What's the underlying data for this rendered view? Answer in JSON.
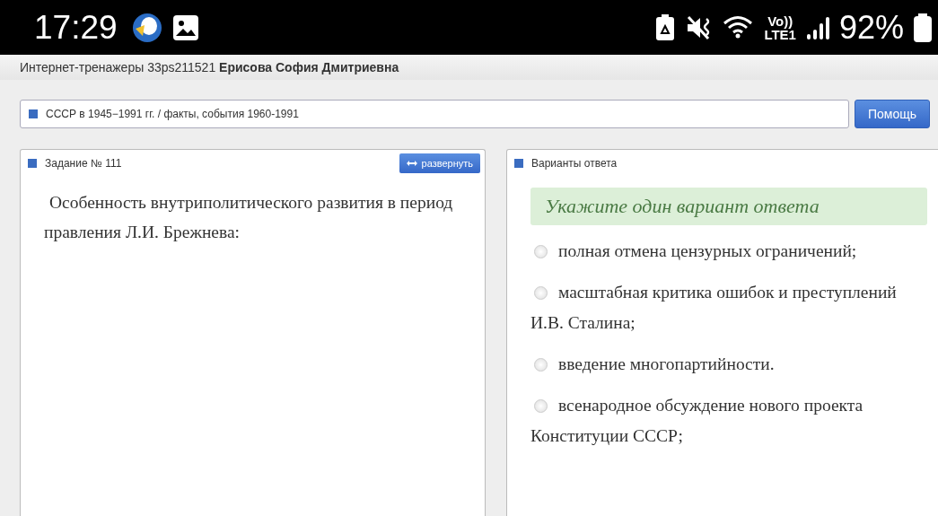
{
  "status_bar": {
    "time": "17:29",
    "network": "Vo))",
    "network_type": "LTE1",
    "battery": "92%"
  },
  "header": {
    "text": "Интернет-тренажеры 33ps211521 **Ерисова София Дмитриевна**"
  },
  "topic": {
    "text": "СССР в 1945−1991 гг. / факты, события 1960-1991",
    "help_button": "Помощь"
  },
  "task": {
    "title": "Задание № 111",
    "expand_button": "развернуть",
    "question": "Особенность внутриполитического развития в период правления Л.И. Брежнева:"
  },
  "answers": {
    "title": "Варианты ответа",
    "instruction": "Укажите один вариант ответа",
    "options": [
      {
        "text": "полная отмена цензурных ограничений;",
        "selected": false
      },
      {
        "text": "масштабная критика ошибок и преступлений И.В. Сталина;",
        "selected": false
      },
      {
        "text": "введение многопартийности.",
        "selected": false
      },
      {
        "text": "всенародное обсуждение нового проекта Конституции СССР;",
        "selected": false
      }
    ]
  }
}
